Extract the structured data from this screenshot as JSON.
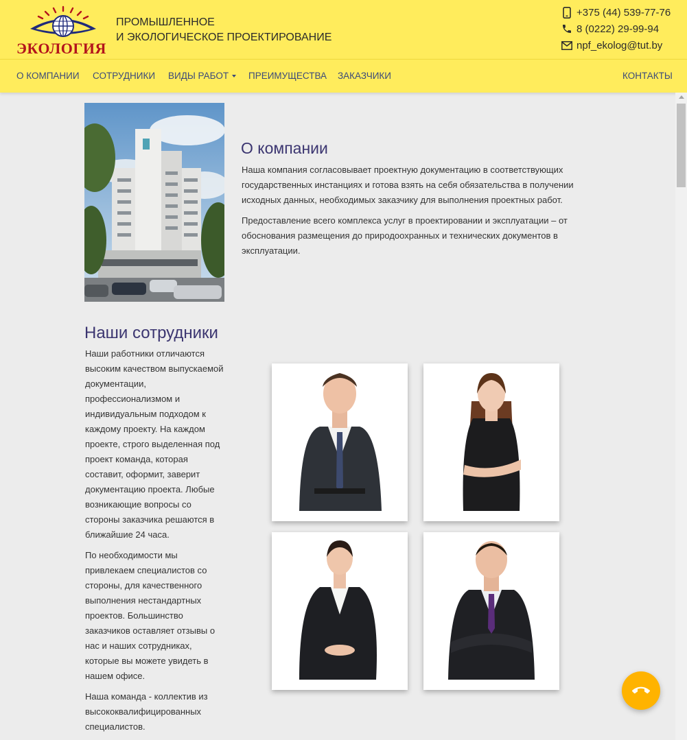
{
  "brand": {
    "logo_text": "ЭКОЛОГИЯ",
    "tagline_line1": "ПРОМЫШЛЕННОЕ",
    "tagline_line2": "И ЭКОЛОГИЧЕСКОЕ ПРОЕКТИРОВАНИЕ"
  },
  "contacts": {
    "mobile": "+375 (44) 539-77-76",
    "phone": "8 (0222) 29-99-94",
    "email": "npf_ekolog@tut.by"
  },
  "nav": {
    "company": "О КОМПАНИИ",
    "staff": "СОТРУДНИКИ",
    "works": "ВИДЫ РАБОТ",
    "advantages": "ПРЕИМУЩЕСТВА",
    "clients": "ЗАКАЗЧИКИ",
    "contacts": "КОНТАКТЫ"
  },
  "about": {
    "title": "О компании",
    "p1": "Наша компания согласовывает проектную документацию в соответствующих государственных инстанциях и готова взять на себя обязательства в получении исходных данных, необходимых заказчику для выполнения проектных работ.",
    "p2": "Предоставление всего комплекса услуг в проектировании и эксплуатации – от обоснования размещения до природоохранных и технических документов в эксплуатации."
  },
  "staff": {
    "title": "Наши сотрудники",
    "p1": "Наши работники отличаются высоким качеством выпускаемой документации, профессионализмом и индивидуальным подходом к каждому проекту. На каждом проекте, строго выделенная под проект команда, которая составит, оформит, заверит документацию проекта. Любые возникающие вопросы со стороны заказчика решаются в ближайшие 24 часа.",
    "p2": "По необходимости мы привлекаем специалистов со стороны, для качественного выполнения нестандартных проектов. Большинство заказчиков оставляет отзывы о нас и наших сотрудниках, которые вы можете увидеть в нашем офисе.",
    "p3": "Наша команда - коллектив из высококвалифицированных специалистов."
  },
  "colors": {
    "header_bg": "#ffec5c",
    "heading": "#3b3570",
    "nav_text": "#3b4a7a",
    "call_button": "#ffb300",
    "logo_red": "#b3141c"
  }
}
